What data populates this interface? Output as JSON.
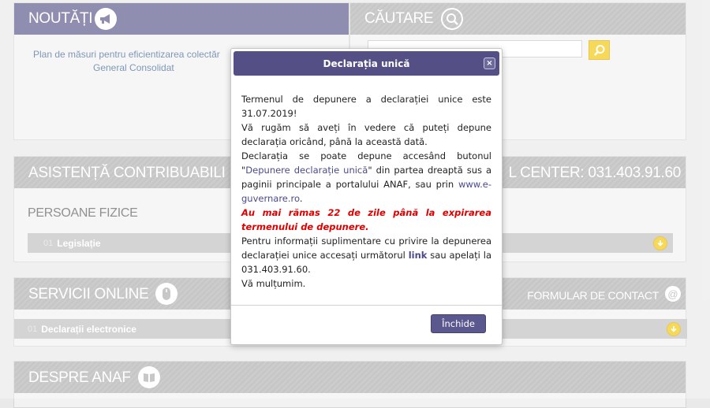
{
  "noutati": {
    "title": "NOUTĂȚI",
    "item_line1": "Plan de măsuri pentru eficientizarea colectăr",
    "item_line2": "General Consolidat"
  },
  "cautare": {
    "title": "CĂUTARE",
    "input_value": ""
  },
  "asistenta": {
    "title": "ASISTENȚĂ CONTRIBUABILI",
    "call_center": "L CENTER: 031.403.91.60",
    "subtitle": "PERSOANE FIZICE",
    "row_num": "01",
    "row_label": "Legislație"
  },
  "servicii": {
    "title": "SERVICII ONLINE",
    "contact": "FORMULAR DE CONTACT",
    "row_num": "01",
    "row_label": "Declarații electronice"
  },
  "despre": {
    "title": "DESPRE ANAF"
  },
  "dialog": {
    "title": "Declarația unică",
    "close_glyph": "×",
    "p1": "Termenul de depunere a declarației unice este 31.07.2019!",
    "p2": "Vă rugăm să aveți în vedere că puteți depune declarația oricând, până la această dată.",
    "p3_pre": "Declarația se poate depune accesând butonul \"",
    "p3_link": "Depunere declarație unică",
    "p3_mid": "\" din partea dreaptă sus a paginii principale a portalului ANAF, sau prin ",
    "p3_link2": "www.e-guvernare.ro",
    "p3_end": ".",
    "warning": "Au mai rămas 22 de zile până la expirarea termenului de depunere.",
    "p4_pre": "Pentru informații suplimentare cu privire la depunerea declarației unice accesați următorul ",
    "p4_link": "link",
    "p4_end": " sau apelați la 031.403.91.60.",
    "p5": "Vă mulțumim.",
    "button": "Închide"
  },
  "colors": {
    "accent_purple": "#545086",
    "gray_header": "#a9a9a9",
    "yellow": "#f2c500",
    "warning_red": "#e00000"
  }
}
